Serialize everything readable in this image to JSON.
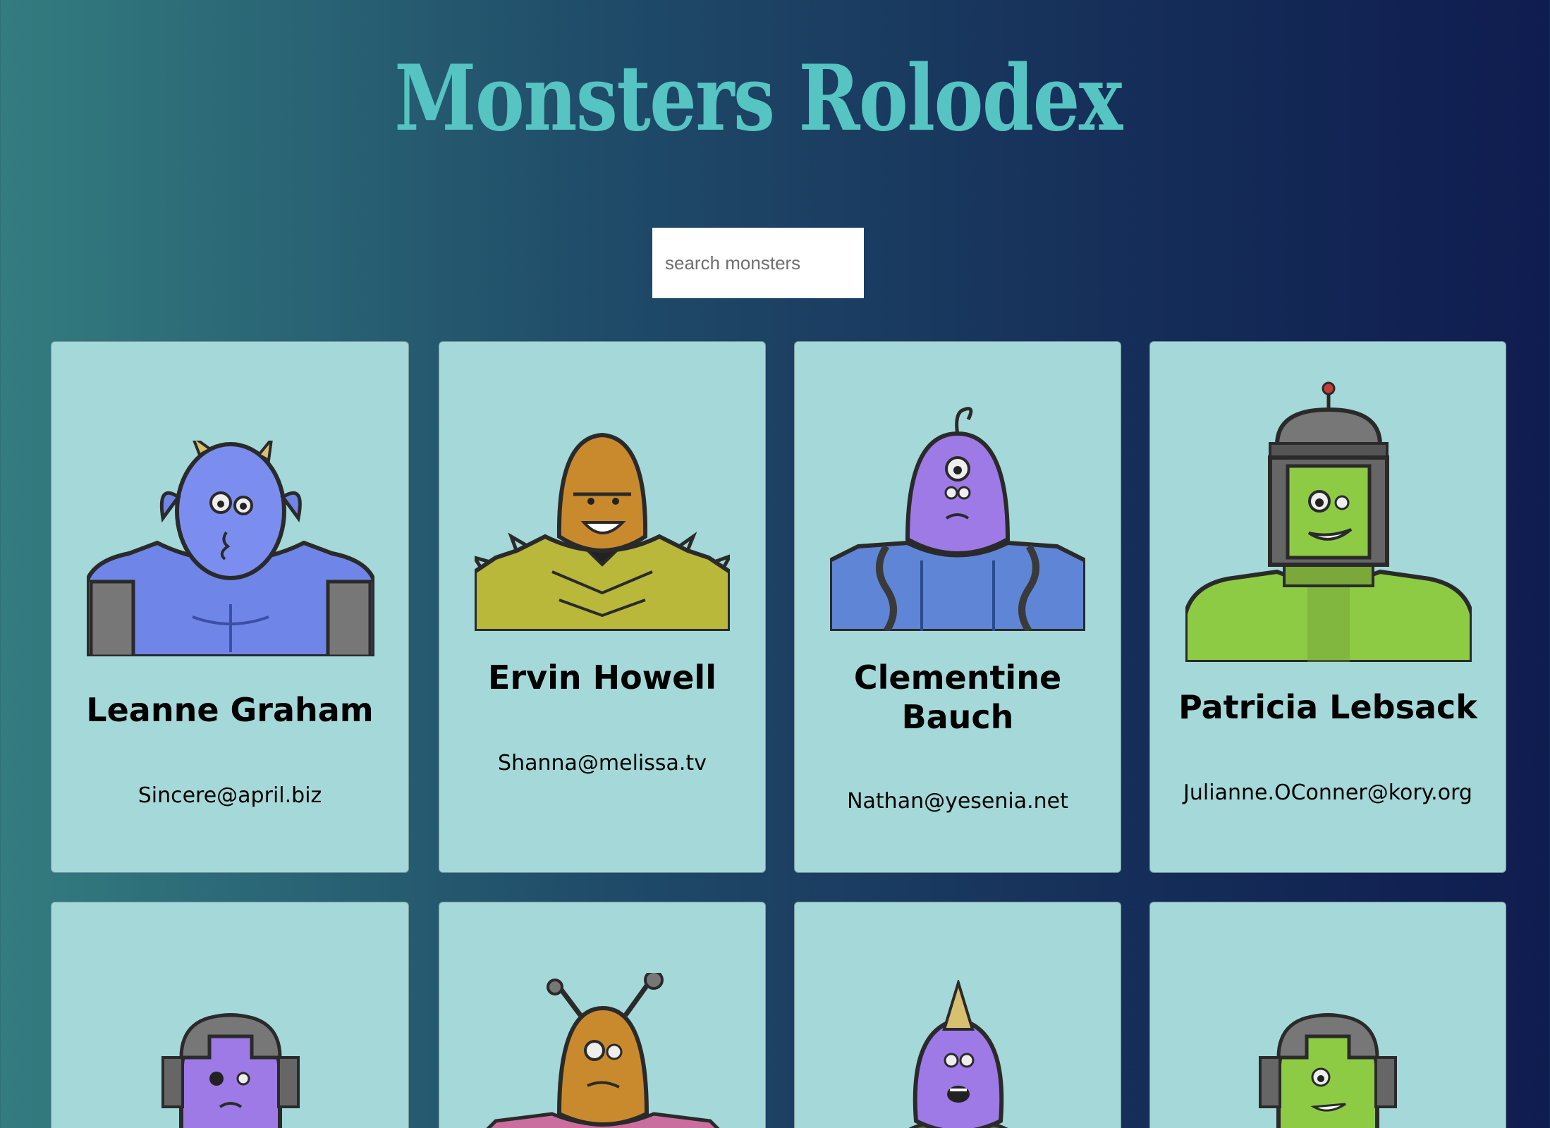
{
  "header": {
    "title": "Monsters Rolodex"
  },
  "search": {
    "placeholder": "search monsters",
    "value": ""
  },
  "monsters": [
    {
      "name": "Leanne Graham",
      "email": "Sincere@april.biz",
      "color": "#7b8ef0",
      "type": "horned"
    },
    {
      "name": "Ervin Howell",
      "email": "Shanna@melissa.tv",
      "color": "#c98a2e",
      "type": "spiky"
    },
    {
      "name": "Clementine Bauch",
      "email": "Nathan@yesenia.net",
      "color": "#9d7ae6",
      "type": "cyclops"
    },
    {
      "name": "Patricia Lebsack",
      "email": "Julianne.OConner@kory.org",
      "color": "#8ecb45",
      "type": "helmet"
    },
    {
      "name": "",
      "email": "",
      "color": "#9d7ae6",
      "type": "robot"
    },
    {
      "name": "",
      "email": "",
      "color": "#c98a2e",
      "type": "antenna"
    },
    {
      "name": "",
      "email": "",
      "color": "#9d7ae6",
      "type": "unicorn"
    },
    {
      "name": "",
      "email": "",
      "color": "#8ecb45",
      "type": "robot"
    }
  ]
}
